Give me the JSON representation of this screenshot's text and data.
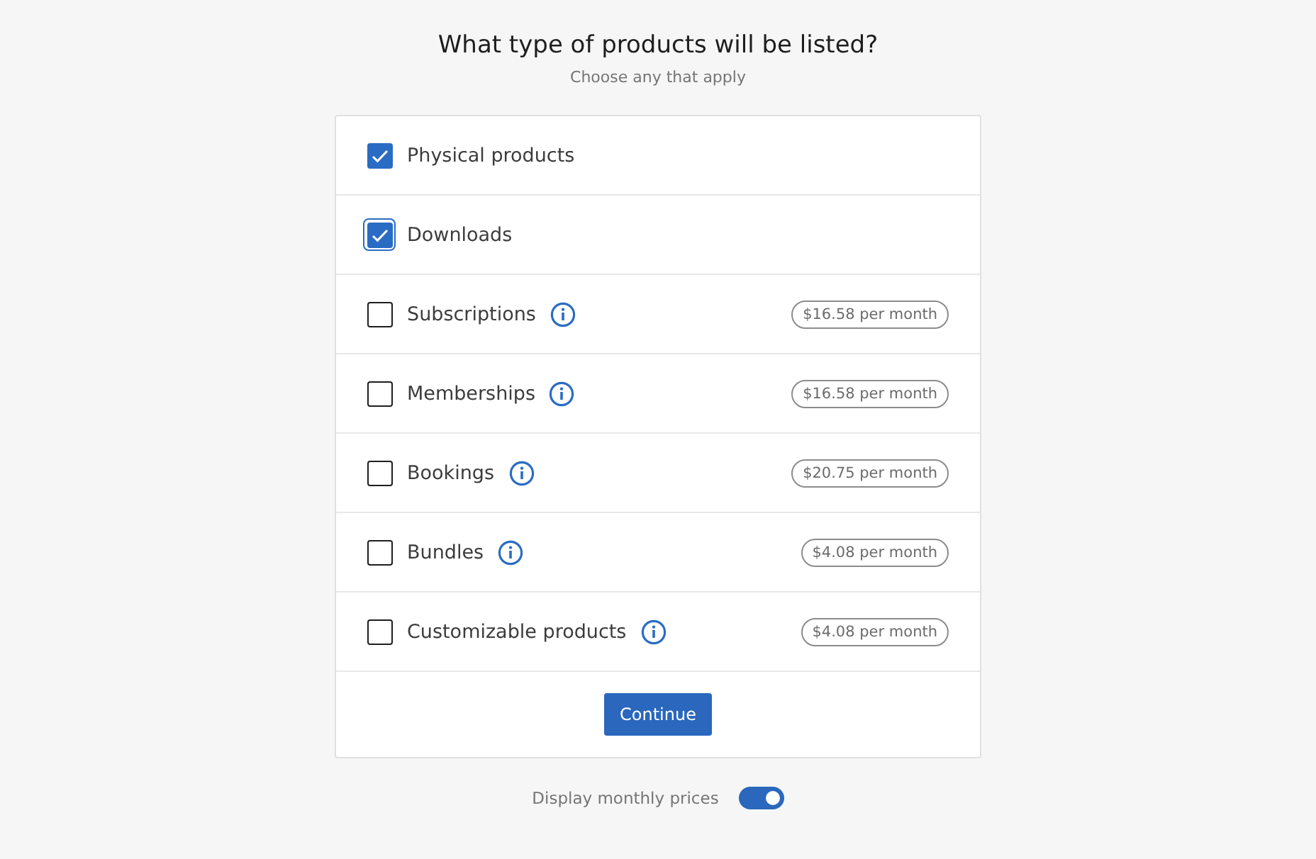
{
  "title": "What type of products will be listed?",
  "subtitle": "Choose any that apply",
  "options": [
    {
      "label": "Physical products",
      "checked": true,
      "focused": false,
      "info": false
    },
    {
      "label": "Downloads",
      "checked": true,
      "focused": true,
      "info": false
    },
    {
      "label": "Subscriptions",
      "checked": false,
      "focused": false,
      "info": true,
      "price": "$16.58 per month"
    },
    {
      "label": "Memberships",
      "checked": false,
      "focused": false,
      "info": true,
      "price": "$16.58 per month"
    },
    {
      "label": "Bookings",
      "checked": false,
      "focused": false,
      "info": true,
      "price": "$20.75 per month"
    },
    {
      "label": "Bundles",
      "checked": false,
      "focused": false,
      "info": true,
      "price": "$4.08 per month"
    },
    {
      "label": "Customizable products",
      "checked": false,
      "focused": false,
      "info": true,
      "price": "$4.08 per month"
    }
  ],
  "continue_button": "Continue",
  "monthly_toggle": {
    "label": "Display monthly prices",
    "on": true
  }
}
